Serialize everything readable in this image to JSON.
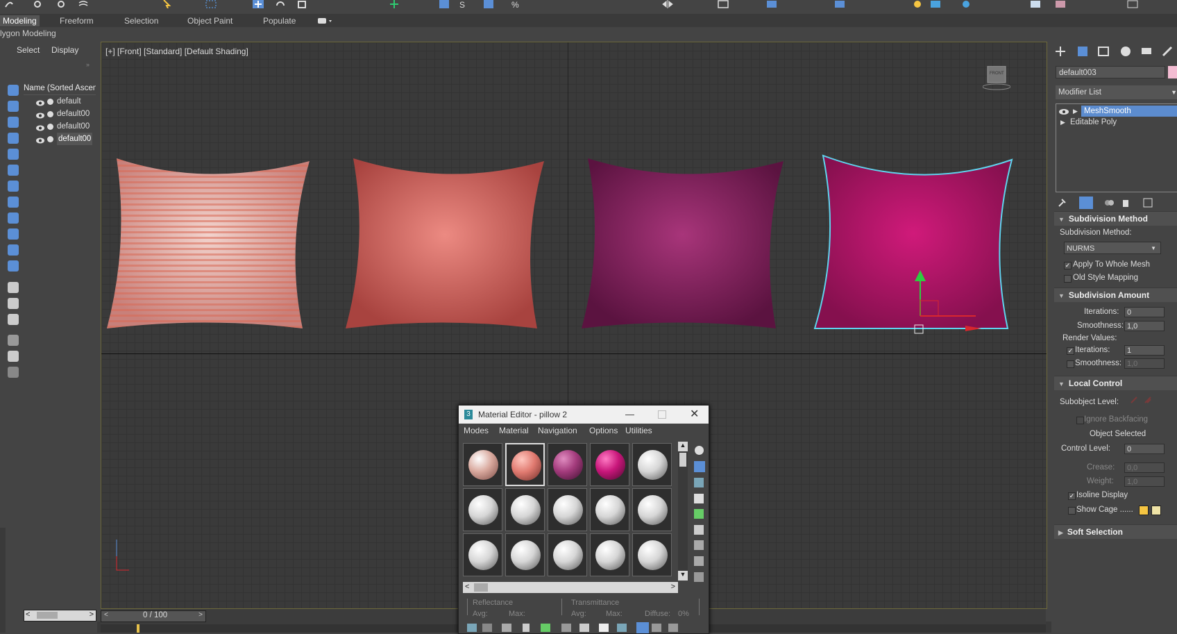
{
  "ribbon": {
    "tabs": [
      "Modeling",
      "Freeform",
      "Selection",
      "Object Paint",
      "Populate"
    ],
    "active_tab": "Modeling",
    "sub_title": "lygon Modeling"
  },
  "explorer": {
    "tabs": [
      "Select",
      "Display"
    ],
    "column_header": "Name (Sorted Ascen",
    "items": [
      "default",
      "default00",
      "default00",
      "default00"
    ],
    "selected_index": 3
  },
  "viewport": {
    "label": "[+] [Front] [Standard] [Default Shading]",
    "viewcube_label": "FRONT",
    "pillow_colors": [
      "#e9b4ac",
      "#e5756e",
      "#9a2c6c",
      "#c4166e"
    ],
    "selection_color": "#5fd4ee"
  },
  "timeline": {
    "frame_text": "0 / 100"
  },
  "command_panel": {
    "object_name": "default003",
    "modifier_list_label": "Modifier List",
    "stack": [
      "MeshSmooth",
      "Editable Poly"
    ],
    "rollouts": {
      "subdivision_method": {
        "title": "Subdivision Method",
        "method_label": "Subdivision Method:",
        "method_value": "NURMS",
        "apply_whole_mesh": "Apply To Whole Mesh",
        "old_style_mapping": "Old Style Mapping"
      },
      "subdivision_amount": {
        "title": "Subdivision Amount",
        "iterations_label": "Iterations:",
        "iterations_value": "0",
        "smoothness_label": "Smoothness:",
        "smoothness_value": "1,0",
        "render_values": "Render Values:",
        "render_iterations_label": "Iterations:",
        "render_iterations_value": "1",
        "render_smoothness_label": "Smoothness:",
        "render_smoothness_value": "1,0"
      },
      "local_control": {
        "title": "Local Control",
        "subobject_level": "Subobject Level:",
        "ignore_backfacing": "Ignore Backfacing",
        "object_selected": "Object Selected",
        "control_level_label": "Control Level:",
        "control_level_value": "0",
        "crease_label": "Crease:",
        "crease_value": "0,0",
        "weight_label": "Weight:",
        "weight_value": "1,0",
        "isoline_display": "Isoline Display",
        "show_cage": "Show Cage ......",
        "cage_colors": [
          "#f5c542",
          "#efe3a6"
        ]
      },
      "soft_selection": {
        "title": "Soft Selection"
      }
    }
  },
  "material_editor": {
    "title": "Material Editor - pillow 2",
    "menu": [
      "Modes",
      "Material",
      "Navigation",
      "Options",
      "Utilities"
    ],
    "slot_colors": [
      "#d9a99e",
      "#e07a70",
      "#a33b7c",
      "#c8167a",
      "#d6d6d6"
    ],
    "reflectance_label": "Reflectance",
    "transmittance_label": "Transmittance",
    "avg_label": "Avg:",
    "max_label": "Max:",
    "diffuse_label": "Diffuse:",
    "diffuse_value": "0%"
  }
}
